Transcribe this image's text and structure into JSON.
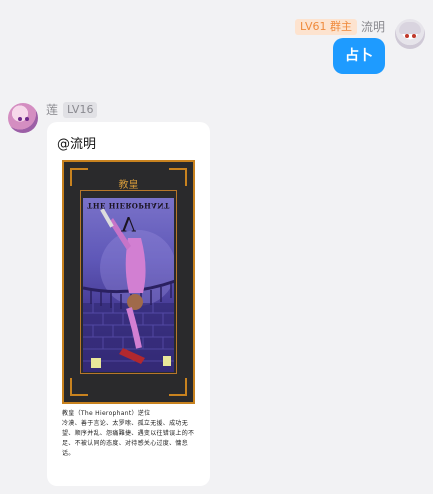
{
  "messages": {
    "outgoing": {
      "level_badge": "LV61 群主",
      "sender": "流明",
      "text": "占卜"
    },
    "incoming": {
      "sender": "莲",
      "level_badge": "LV16",
      "mention": "@流明",
      "tarot": {
        "title": "教皇",
        "name": "THE HIEROPHANT",
        "numeral": "V",
        "orientation": "reversed"
      },
      "caption": "教皇（The Hierophant）逆位\n冷漠、善于言论、太罗嗦、孤立无援、成功无望、顺序并乱、怨痛難捷、遇变以往错误上的不足、不被认同的态度、对待感关心过度、慵怠话。"
    }
  },
  "colors": {
    "bubble_blue": "#1e9bff",
    "owner_badge_bg": "#fde3cf",
    "owner_badge_text": "#ef8a3c",
    "tarot_border": "#c8821f"
  }
}
